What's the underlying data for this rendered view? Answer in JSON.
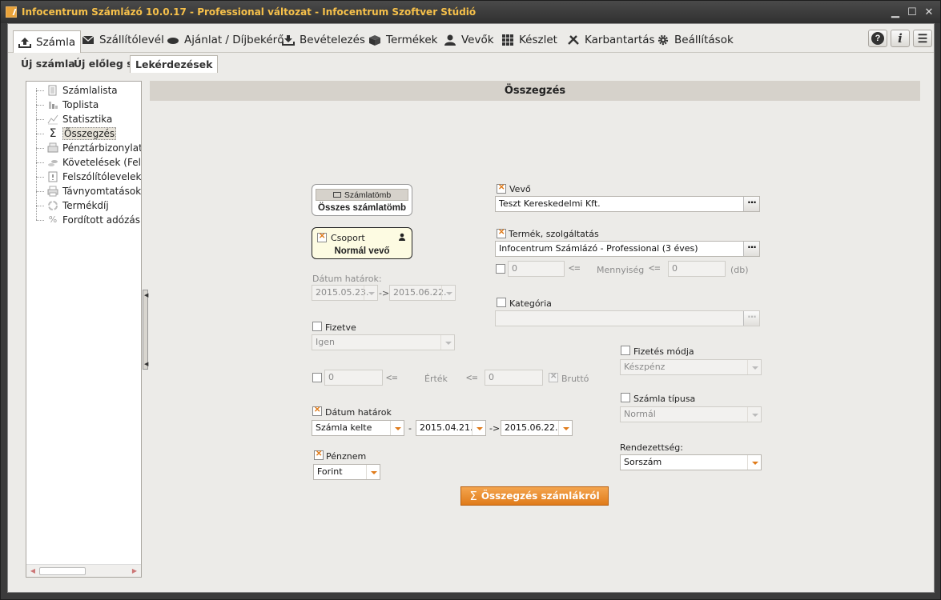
{
  "window": {
    "title": "Infocentrum Számlázó 10.0.17 - Professional változat - Infocentrum Szoftver Stúdió",
    "min": "▁",
    "max": "☐",
    "close": "✕"
  },
  "menu": {
    "items": [
      {
        "label": "Számla",
        "icon": "upload-icon"
      },
      {
        "label": "Szállítólevél",
        "icon": "envelope-icon"
      },
      {
        "label": "Ajánlat / Díjbekérő",
        "icon": "handshake-icon"
      },
      {
        "label": "Bevételezés",
        "icon": "download-icon"
      },
      {
        "label": "Termékek",
        "icon": "box-icon"
      },
      {
        "label": "Vevők",
        "icon": "user-icon"
      },
      {
        "label": "Készlet",
        "icon": "grid-icon"
      },
      {
        "label": "Karbantartás",
        "icon": "tools-icon"
      },
      {
        "label": "Beállítások",
        "icon": "gear-icon"
      }
    ],
    "help": "?",
    "info": "i",
    "list": "☰"
  },
  "subtabs": [
    "Új számla",
    "Új előleg számla",
    "Lekérdezések"
  ],
  "tree": {
    "items": [
      "Számlalista",
      "Toplista",
      "Statisztika",
      "Összegzés",
      "Pénztárbizonylat",
      "Követelések (Felsz",
      "Felszólítólevelek li",
      "Távnyomtatások",
      "Termékdíj",
      "Fordított adózású t"
    ],
    "selected_index": 3
  },
  "content": {
    "header": "Összegzés",
    "szamlatomb": {
      "button": "Számlatömb",
      "value": "Összes számlatömb"
    },
    "csoport": {
      "label": "Csoport",
      "value": "Normál vevő"
    },
    "datum_hatarok_dis": {
      "label": "Dátum határok:",
      "from": "2015.05.23.",
      "arrow": "->",
      "to": "2015.06.22."
    },
    "fizetve": {
      "label": "Fizetve",
      "value": "Igen"
    },
    "ertek": {
      "from": "0",
      "op1": "<=",
      "label": "Érték",
      "op2": "<=",
      "to": "0",
      "brutto": "Bruttó"
    },
    "datum_hatarok": {
      "label": "Dátum határok",
      "type": "Számla kelte",
      "dash": "-",
      "from": "2015.04.21.",
      "arrow": "->",
      "to": "2015.06.22."
    },
    "penznem": {
      "label": "Pénznem",
      "value": "Forint"
    },
    "vevo": {
      "label": "Vevő",
      "value": "Teszt Kereskedelmi Kft.",
      "ellipsis": "···"
    },
    "termek": {
      "label": "Termék, szolgáltatás",
      "value": "Infocentrum Számlázó - Professional (3 éves)",
      "ellipsis": "···"
    },
    "mennyiseg": {
      "from": "0",
      "op1": "<=",
      "label": "Mennyiség",
      "op2": "<=",
      "to": "0",
      "unit": "(db)"
    },
    "kategoria": {
      "label": "Kategória",
      "ellipsis": "···"
    },
    "fizetes_modja": {
      "label": "Fizetés módja",
      "value": "Készpénz"
    },
    "szamla_tipusa": {
      "label": "Számla típusa",
      "value": "Normál"
    },
    "rendezettseg": {
      "label": "Rendezettség:",
      "value": "Sorszám"
    },
    "submit": {
      "icon": "Σ",
      "label": "Összegzés számlákról"
    }
  },
  "colors": {
    "accent": "#e07b1a",
    "title": "#f6c04a"
  }
}
